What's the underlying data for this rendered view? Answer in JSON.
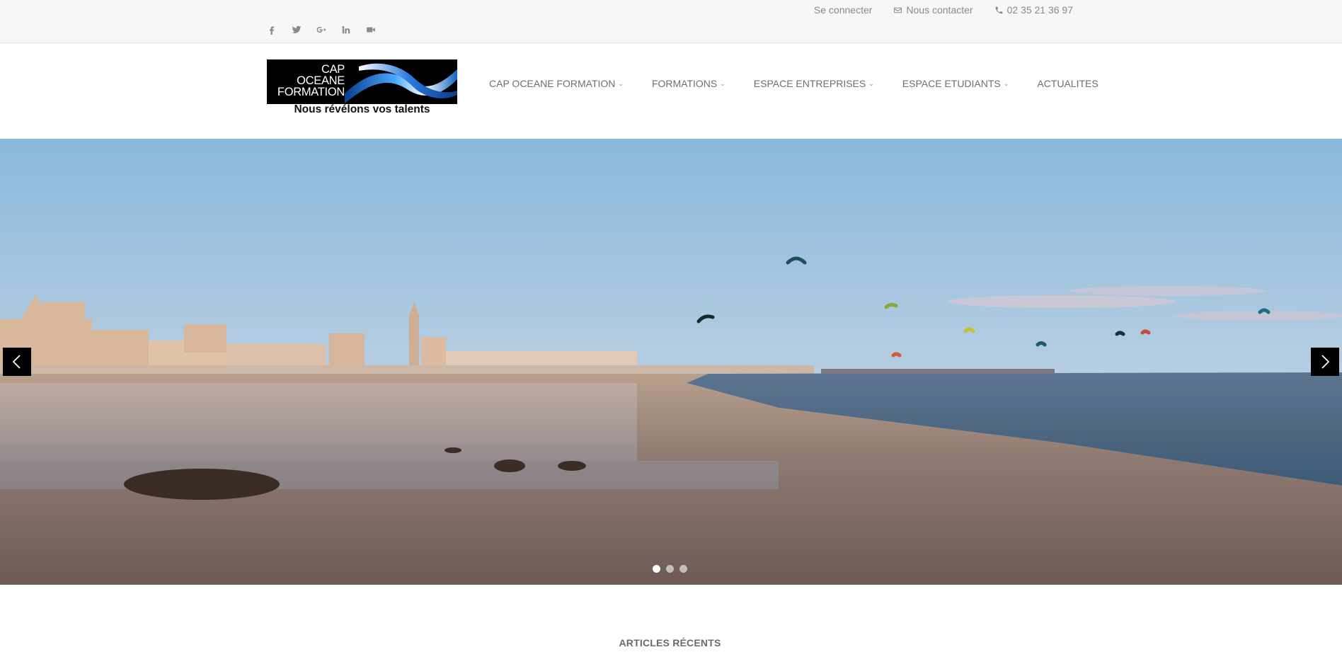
{
  "topbar": {
    "login": "Se connecter",
    "contact": "Nous contacter",
    "phone": "02 35 21 36 97",
    "socials": [
      "facebook-icon",
      "twitter-icon",
      "google-plus-icon",
      "linkedin-icon",
      "video-camera-icon"
    ]
  },
  "logo": {
    "line1": "CAP",
    "line2": "OCEANE",
    "line3": "FORMATION",
    "tagline": "Nous révélons vos talents"
  },
  "nav": {
    "items": [
      {
        "label": "CAP OCEANE FORMATION",
        "dropdown": true
      },
      {
        "label": "FORMATIONS",
        "dropdown": true
      },
      {
        "label": "ESPACE ENTREPRISES",
        "dropdown": true
      },
      {
        "label": "ESPACE ETUDIANTS",
        "dropdown": true
      },
      {
        "label": "ACTUALITES",
        "dropdown": false
      }
    ]
  },
  "slider": {
    "slide_count": 3,
    "active_index": 0
  },
  "section": {
    "title": "ARTICLES RÉCENTS"
  },
  "colors": {
    "topbar_bg": "#f7f7f7",
    "text_muted": "#8a8a8a",
    "nav_text": "#6f6f6f"
  }
}
